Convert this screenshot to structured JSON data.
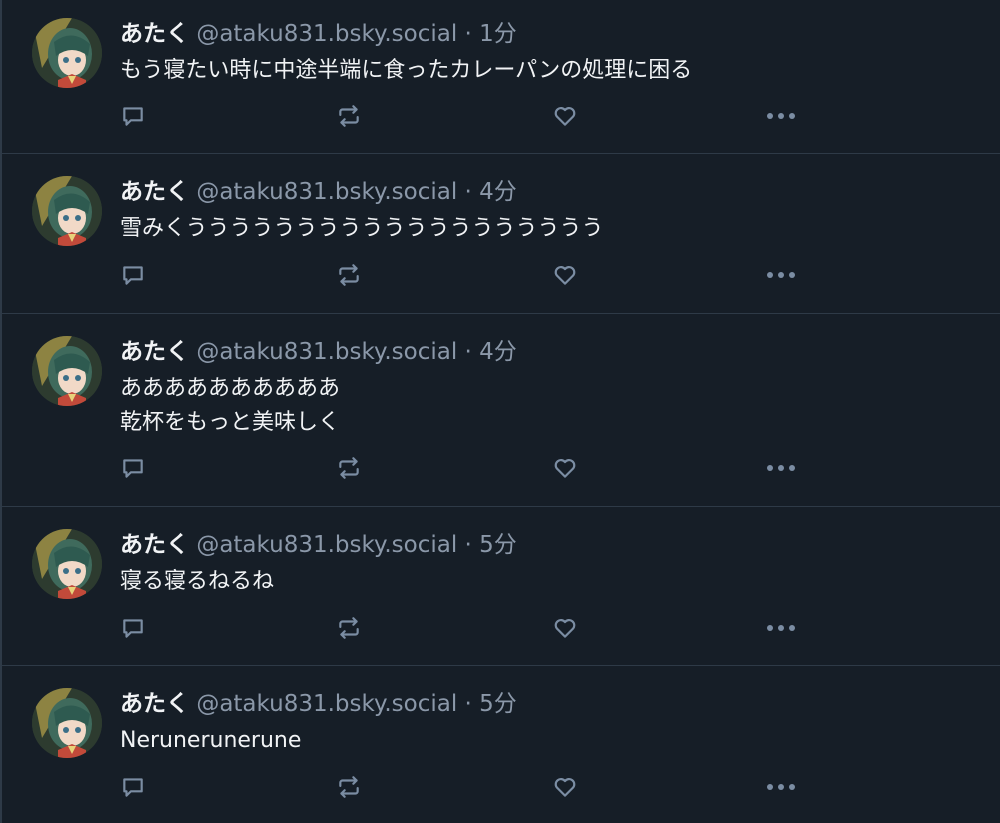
{
  "colors": {
    "background": "#161e27",
    "divider": "#2e3a47",
    "text_primary": "#f1f3f5",
    "text_secondary": "#8b98a9",
    "icon": "#7b8da3"
  },
  "posts": [
    {
      "author_name": "あたく",
      "handle": "@ataku831.bsky.social",
      "separator": "·",
      "time": "1分",
      "lines": [
        "もう寝たい時に中途半端に食ったカレーパンの処理に困る"
      ]
    },
    {
      "author_name": "あたく",
      "handle": "@ataku831.bsky.social",
      "separator": "·",
      "time": "4分",
      "lines": [
        "雪みくううううううううううううううううううう"
      ]
    },
    {
      "author_name": "あたく",
      "handle": "@ataku831.bsky.social",
      "separator": "·",
      "time": "4分",
      "lines": [
        "ああああああああああ",
        "乾杯をもっと美味しく"
      ]
    },
    {
      "author_name": "あたく",
      "handle": "@ataku831.bsky.social",
      "separator": "·",
      "time": "5分",
      "lines": [
        "寝る寝るねるね"
      ]
    },
    {
      "author_name": "あたく",
      "handle": "@ataku831.bsky.social",
      "separator": "·",
      "time": "5分",
      "lines": [
        "Nerunerunerune"
      ]
    }
  ],
  "icons": {
    "avatar": "avatar-anime-girl",
    "reply": "reply-icon",
    "repost": "repost-icon",
    "like": "heart-icon",
    "more": "more-icon"
  }
}
